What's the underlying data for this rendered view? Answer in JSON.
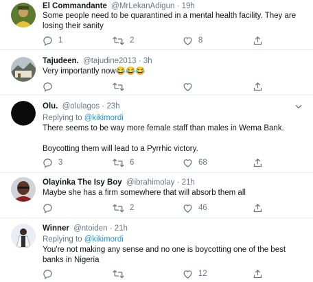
{
  "tweets": [
    {
      "name": "El Commandante",
      "handle": "@MrLekanAdigun",
      "time": "19h",
      "replying_prefix": "",
      "replying_to": "",
      "text": [
        "Some people need to be quarantined in a mental health facility. They are losing their sanity"
      ],
      "replies": "1",
      "retweets": "2",
      "likes": "8",
      "avatar_color": "#d9b23a"
    },
    {
      "name": "Tajudeen.",
      "handle": "@tajudine2013",
      "time": "3h",
      "replying_prefix": "",
      "replying_to": "",
      "text": [
        "Very importantly now😂😂😂"
      ],
      "replies": "",
      "retweets": "",
      "likes": "",
      "avatar_color": "#8a8f8a"
    },
    {
      "name": "Olu.",
      "handle": "@olulagos",
      "time": "23h",
      "replying_prefix": "Replying to",
      "replying_to": "@kikimordi",
      "text": [
        "There seems to be way more female staff than males in Wema Bank.",
        "Boycotting them will lead to a Pyrrhic victory."
      ],
      "replies": "3",
      "retweets": "6",
      "likes": "68",
      "avatar_color": "#0b0b0b"
    },
    {
      "name": "Olayinka The Isy Boy",
      "handle": "@ibrahimolay",
      "time": "21h",
      "replying_prefix": "",
      "replying_to": "",
      "text": [
        "Maybe she has a firm somewhere that will absorb them all"
      ],
      "replies": "",
      "retweets": "2",
      "likes": "46",
      "avatar_color": "#6b3a2a"
    },
    {
      "name": "Winner",
      "handle": "@ntoiden",
      "time": "21h",
      "replying_prefix": "Replying to",
      "replying_to": "@kikimordi",
      "text": [
        "You're not making any sense and no one is boycotting one of the best banks in Nigeria"
      ],
      "replies": "",
      "retweets": "",
      "likes": "12",
      "avatar_color": "#dfe7ee"
    }
  ],
  "separator": "·",
  "colors": {
    "text": "#14171a",
    "secondary": "#657786",
    "link": "#1b95e0",
    "divider": "#e6ecf0"
  },
  "icons": [
    "reply-icon",
    "retweet-icon",
    "like-icon",
    "share-icon",
    "more-icon"
  ]
}
